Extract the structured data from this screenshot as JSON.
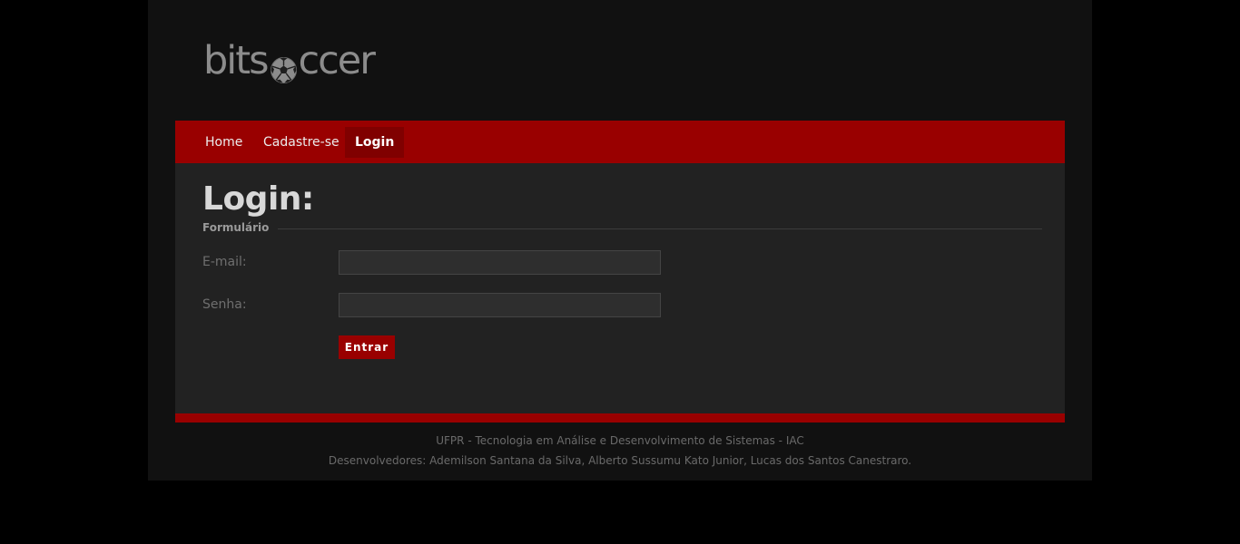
{
  "brand": {
    "text_before": "bits",
    "icon": "soccer-ball-icon",
    "text_after": "ccer"
  },
  "nav": {
    "items": [
      {
        "label": "Home",
        "active": false
      },
      {
        "label": "Cadastre-se",
        "active": false
      },
      {
        "label": "Login",
        "active": true
      }
    ]
  },
  "main": {
    "title": "Login:",
    "legend": "Formulário",
    "fields": {
      "email": {
        "label": "E-mail:",
        "value": ""
      },
      "password": {
        "label": "Senha:",
        "value": ""
      }
    },
    "submit_label": "Entrar"
  },
  "footer": {
    "line1": "UFPR - Tecnologia em Análise e Desenvolvimento de Sistemas - IAC",
    "line2": "Desenvolvedores: Ademilson Santana da Silva, Alberto Sussumu Kato Junior, Lucas dos Santos Canestraro."
  },
  "colors": {
    "background": "#000000",
    "page": "#111111",
    "content": "#222222",
    "accent": "#990000",
    "accent_dark": "#800000"
  }
}
